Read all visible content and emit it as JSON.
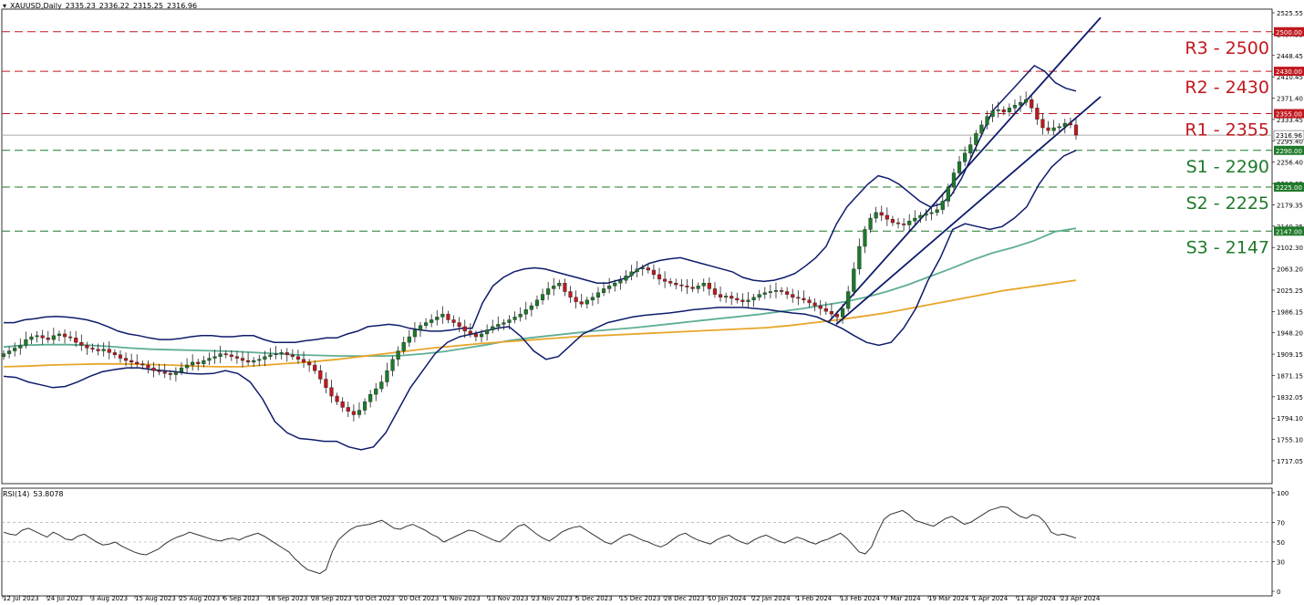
{
  "header": {
    "symbol": "XAUUSD,Daily",
    "open": "2335.23",
    "high": "2336.22",
    "low": "2315.25",
    "close": "2316.96"
  },
  "rsi_header": {
    "label": "RSI(14)",
    "value": "53.8078"
  },
  "colors": {
    "bull": "#1b7a2a",
    "bear": "#c0181e",
    "band": "#0f1c6b",
    "channel": "#0f1c6b",
    "ma_green": "#5fae96",
    "ma_orange": "#e8a52a",
    "resistance": "#c0181e",
    "support": "#1f7a2a",
    "price_line": "#a8a8a8",
    "rsi_line": "#333333"
  },
  "chart_data": [
    {
      "type": "candlestick",
      "title": "XAUUSD,Daily",
      "ylim": [
        1700,
        2540
      ],
      "y_ticks": [
        "2525.55",
        "2487.55",
        "2448.45",
        "2410.45",
        "2371.40",
        "2333.45",
        "2295.40",
        "2256.40",
        "2218.35",
        "2179.35",
        "2140.35",
        "2102.30",
        "2063.20",
        "2025.25",
        "1986.15",
        "1948.20",
        "1909.15",
        "1871.15",
        "1832.05",
        "1794.10",
        "1755.10",
        "1717.05"
      ],
      "x_ticks": [
        "12 Jul 2023",
        "24 Jul 2023",
        "3 Aug 2023",
        "15 Aug 2023",
        "25 Aug 2023",
        "6 Sep 2023",
        "18 Sep 2023",
        "28 Sep 2023",
        "10 Oct 2023",
        "20 Oct 2023",
        "1 Nov 2023",
        "13 Nov 2023",
        "23 Nov 2023",
        "5 Dec 2023",
        "15 Dec 2023",
        "28 Dec 2023",
        "10 Jan 2024",
        "22 Jan 2024",
        "1 Feb 2024",
        "13 Feb 2024",
        "7 Mar 2024",
        "19 Mar 2024",
        "1 Apr 2024",
        "11 Apr 2024",
        "23 Apr 2024"
      ],
      "levels": [
        {
          "label": "R3 - 2500",
          "value": 2500,
          "tag": "2500.00",
          "kind": "resistance"
        },
        {
          "label": "R2 - 2430",
          "value": 2430,
          "tag": "2430.00",
          "kind": "resistance"
        },
        {
          "label": "R1 - 2355",
          "value": 2355,
          "tag": "2355.00",
          "kind": "resistance"
        },
        {
          "label": "S1 - 2290",
          "value": 2290,
          "tag": "2290.00",
          "kind": "support"
        },
        {
          "label": "S2 - 2225",
          "value": 2225,
          "tag": "2225.00",
          "kind": "support"
        },
        {
          "label": "S3 - 2147",
          "value": 2147,
          "tag": "2147.00",
          "kind": "support"
        }
      ],
      "last_price": {
        "value": 2316.96,
        "tag": "2316.96"
      },
      "close": [
        1930,
        1935,
        1940,
        1945,
        1955,
        1960,
        1962,
        1958,
        1955,
        1962,
        1965,
        1960,
        1958,
        1950,
        1945,
        1940,
        1938,
        1935,
        1938,
        1932,
        1928,
        1922,
        1918,
        1915,
        1912,
        1910,
        1905,
        1900,
        1898,
        1895,
        1893,
        1898,
        1905,
        1910,
        1915,
        1912,
        1918,
        1922,
        1925,
        1930,
        1928,
        1925,
        1922,
        1918,
        1915,
        1918,
        1920,
        1925,
        1928,
        1930,
        1932,
        1928,
        1925,
        1920,
        1915,
        1910,
        1900,
        1885,
        1870,
        1855,
        1845,
        1835,
        1828,
        1822,
        1830,
        1845,
        1858,
        1868,
        1880,
        1900,
        1920,
        1935,
        1950,
        1960,
        1972,
        1980,
        1985,
        1990,
        1995,
        2000,
        1990,
        1985,
        1978,
        1970,
        1965,
        1960,
        1965,
        1972,
        1978,
        1982,
        1985,
        1990,
        1995,
        2000,
        2008,
        2015,
        2025,
        2035,
        2045,
        2050,
        2055,
        2040,
        2030,
        2022,
        2018,
        2025,
        2030,
        2038,
        2045,
        2050,
        2055,
        2060,
        2068,
        2075,
        2080,
        2082,
        2078,
        2070,
        2062,
        2058,
        2055,
        2052,
        2050,
        2048,
        2045,
        2050,
        2055,
        2045,
        2035,
        2030,
        2032,
        2028,
        2025,
        2022,
        2025,
        2030,
        2035,
        2038,
        2040,
        2042,
        2040,
        2035,
        2030,
        2028,
        2025,
        2020,
        2015,
        2010,
        2005,
        2000,
        1995,
        2010,
        2040,
        2080,
        2120,
        2150,
        2170,
        2180,
        2175,
        2168,
        2162,
        2160,
        2158,
        2165,
        2170,
        2175,
        2178,
        2180,
        2185,
        2200,
        2225,
        2250,
        2270,
        2285,
        2300,
        2320,
        2335,
        2350,
        2360,
        2362,
        2358,
        2365,
        2370,
        2375,
        2380,
        2365,
        2345,
        2330,
        2325,
        2330,
        2332,
        2338,
        2335,
        2317
      ],
      "bands": [
        {
          "name": "upper",
          "values": [
            1985,
            1985,
            1990,
            1992,
            1995,
            1996,
            1995,
            1993,
            1990,
            1985,
            1978,
            1970,
            1965,
            1962,
            1958,
            1955,
            1955,
            1957,
            1960,
            1962,
            1962,
            1960,
            1960,
            1962,
            1962,
            1955,
            1950,
            1950,
            1950,
            1953,
            1955,
            1958,
            1958,
            1965,
            1970,
            1978,
            1980,
            1982,
            1980,
            1975,
            1972,
            1970,
            1970,
            1972,
            1975,
            1975,
            2020,
            2050,
            2065,
            2075,
            2080,
            2082,
            2080,
            2075,
            2070,
            2065,
            2060,
            2055,
            2055,
            2060,
            2065,
            2080,
            2090,
            2095,
            2098,
            2100,
            2095,
            2090,
            2085,
            2080,
            2075,
            2065,
            2060,
            2058,
            2060,
            2065,
            2072,
            2085,
            2100,
            2120,
            2160,
            2190,
            2210,
            2230,
            2245,
            2240,
            2230,
            2215,
            2200,
            2190,
            2195,
            2210,
            2240,
            2280,
            2320,
            2360,
            2380,
            2400,
            2420,
            2440,
            2430,
            2410,
            2400,
            2395
          ]
        },
        {
          "name": "lower",
          "values": [
            1890,
            1888,
            1880,
            1875,
            1870,
            1872,
            1880,
            1890,
            1898,
            1902,
            1905,
            1905,
            1902,
            1900,
            1898,
            1895,
            1894,
            1895,
            1900,
            1895,
            1880,
            1850,
            1810,
            1790,
            1780,
            1778,
            1775,
            1775,
            1765,
            1760,
            1765,
            1790,
            1830,
            1870,
            1900,
            1930,
            1950,
            1960,
            1965,
            1970,
            1975,
            1978,
            1960,
            1935,
            1920,
            1925,
            1945,
            1965,
            1975,
            1985,
            1990,
            1995,
            1998,
            2000,
            2002,
            2005,
            2008,
            2010,
            2012,
            2012,
            2012,
            2010,
            2008,
            2005,
            2002,
            2000,
            1995,
            1985,
            1975,
            1962,
            1950,
            1945,
            1950,
            1975,
            2010,
            2060,
            2100,
            2150,
            2160,
            2155,
            2150,
            2155,
            2170,
            2190,
            2230,
            2260,
            2280,
            2290
          ]
        }
      ],
      "moving_averages": [
        {
          "name": "ma_green",
          "values": [
            1942,
            1945,
            1946,
            1946,
            1945,
            1943,
            1940,
            1938,
            1937,
            1936,
            1935,
            1934,
            1932,
            1930,
            1928,
            1927,
            1926,
            1926,
            1926,
            1927,
            1930,
            1934,
            1940,
            1946,
            1953,
            1958,
            1962,
            1966,
            1970,
            1973,
            1976,
            1980,
            1984,
            1988,
            1992,
            1996,
            2000,
            2005,
            2010,
            2016,
            2022,
            2030,
            2040,
            2052,
            2066,
            2080,
            2095,
            2108,
            2118,
            2130,
            2146,
            2152
          ]
        },
        {
          "name": "ma_orange",
          "values": [
            1907,
            1908,
            1910,
            1911,
            1912,
            1912,
            1911,
            1910,
            1908,
            1907,
            1907,
            1910,
            1913,
            1916,
            1920,
            1925,
            1930,
            1935,
            1940,
            1944,
            1948,
            1951,
            1954,
            1957,
            1960,
            1962,
            1964,
            1966,
            1968,
            1970,
            1972,
            1974,
            1976,
            1980,
            1985,
            1990,
            1996,
            2002,
            2010,
            2018,
            2026,
            2034,
            2042,
            2048,
            2054,
            2060
          ]
        }
      ],
      "channel": [
        {
          "name": "upper",
          "from": 1985,
          "to": 2525
        },
        {
          "name": "lower",
          "from": 1982,
          "to": 2385
        }
      ]
    },
    {
      "type": "line",
      "title": "RSI(14) 53.8078",
      "ylim": [
        0,
        100
      ],
      "y_ticks": [
        "100",
        "70",
        "50",
        "30",
        "0"
      ],
      "levels": [
        70,
        50,
        30
      ],
      "series": [
        {
          "values": [
            60,
            58,
            57,
            62,
            64,
            61,
            58,
            55,
            60,
            57,
            53,
            52,
            56,
            58,
            54,
            50,
            47,
            48,
            50,
            46,
            43,
            40,
            38,
            37,
            40,
            43,
            48,
            52,
            55,
            57,
            60,
            58,
            56,
            54,
            52,
            51,
            53,
            54,
            52,
            55,
            57,
            59,
            56,
            52,
            48,
            44,
            40,
            33,
            27,
            22,
            20,
            18,
            22,
            40,
            52,
            58,
            63,
            66,
            67,
            68,
            70,
            72,
            68,
            64,
            63,
            66,
            68,
            65,
            62,
            58,
            55,
            50,
            53,
            56,
            59,
            62,
            61,
            58,
            55,
            52,
            50,
            55,
            61,
            66,
            68,
            63,
            58,
            54,
            51,
            55,
            60,
            63,
            65,
            66,
            62,
            58,
            54,
            50,
            48,
            52,
            56,
            58,
            55,
            52,
            50,
            47,
            45,
            48,
            53,
            57,
            59,
            55,
            52,
            50,
            48,
            52,
            55,
            57,
            53,
            50,
            48,
            52,
            55,
            57,
            54,
            51,
            49,
            52,
            55,
            53,
            50,
            48,
            51,
            53,
            56,
            59,
            54,
            47,
            40,
            38,
            45,
            60,
            73,
            78,
            80,
            82,
            78,
            72,
            70,
            68,
            66,
            70,
            74,
            76,
            72,
            68,
            70,
            74,
            78,
            82,
            84,
            86,
            85,
            80,
            76,
            74,
            78,
            76,
            70,
            60,
            57,
            58,
            56,
            54
          ]
        }
      ]
    }
  ]
}
